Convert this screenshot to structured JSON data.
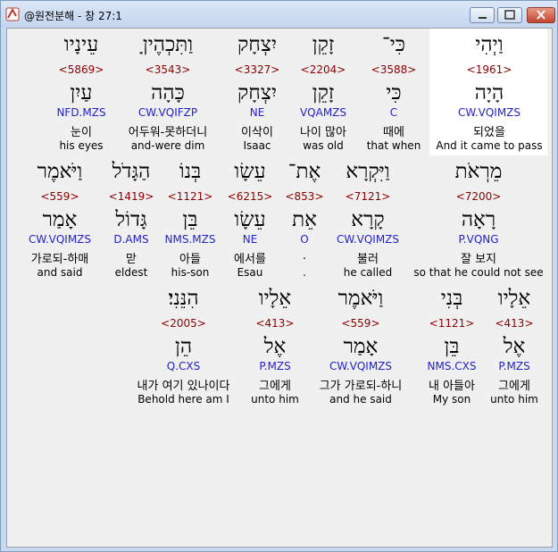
{
  "window": {
    "title": "@원전분해 - 창 27:1"
  },
  "rows": [
    {
      "words": [
        {
          "heb": "וַיְהִי",
          "strong": "<1961>",
          "lemma": "הָיָה",
          "morph": "CW.VQIMZS",
          "kor": "되었을",
          "eng": "And it came to pass"
        },
        {
          "heb": "כִּי־",
          "strong": "<3588>",
          "lemma": "כִּי",
          "morph": "C",
          "kor": "때에",
          "eng": "that when"
        },
        {
          "heb": "זָקֵן",
          "strong": "<2204>",
          "lemma": "זָקֵן",
          "morph": "VQAMZS",
          "kor": "나이 많아",
          "eng": "was old"
        },
        {
          "heb": "יִצְחָק",
          "strong": "<3327>",
          "lemma": "יִצְחָק",
          "morph": "NE",
          "kor": "이삭이",
          "eng": "Isaac"
        },
        {
          "heb": "וַתִּכְהֶיןָ",
          "strong": "<3543>",
          "lemma": "כָּהָה",
          "morph": "CW.VQIFZP",
          "kor": "어두워-못하더니",
          "eng": "and-were dim"
        },
        {
          "heb": "עֵינָיו",
          "strong": "<5869>",
          "lemma": "עַיִן",
          "morph": "NFD.MZS",
          "kor": "눈이",
          "eng": "his eyes"
        }
      ]
    },
    {
      "words": [
        {
          "heb": "מֵרְאֹת",
          "strong": "<7200>",
          "lemma": "רָאָה",
          "morph": "P.VQNG",
          "kor": "잘 보지",
          "eng": "so that he could not see"
        },
        {
          "heb": "וַיִּקְרָא",
          "strong": "<7121>",
          "lemma": "קָרָא",
          "morph": "CW.VQIMZS",
          "kor": "불러",
          "eng": "he called"
        },
        {
          "heb": "אֶת־",
          "strong": "<853>",
          "lemma": "אֵת",
          "morph": "O",
          "kor": ".",
          "eng": "."
        },
        {
          "heb": "עֵשָׂו",
          "strong": "<6215>",
          "lemma": "עֵשָׂו",
          "morph": "NE",
          "kor": "에서를",
          "eng": "Esau"
        },
        {
          "heb": "בְּנוֹ",
          "strong": "<1121>",
          "lemma": "בֵּן",
          "morph": "NMS.MZS",
          "kor": "아들",
          "eng": "his-son"
        },
        {
          "heb": "הַגָּדֹל",
          "strong": "<1419>",
          "lemma": "גָּדוֹל",
          "morph": "D.AMS",
          "kor": "맏",
          "eng": "eldest"
        },
        {
          "heb": "וַיֹּאמֶר",
          "strong": "<559>",
          "lemma": "אָמַר",
          "morph": "CW.VQIMZS",
          "kor": "가로되-하매",
          "eng": "and said"
        }
      ]
    },
    {
      "words": [
        {
          "heb": "אֵלָיו",
          "strong": "<413>",
          "lemma": "אֶל",
          "morph": "P.MZS",
          "kor": "그에게",
          "eng": "unto him"
        },
        {
          "heb": "בְּנִי",
          "strong": "<1121>",
          "lemma": "בֵּן",
          "morph": "NMS.CXS",
          "kor": "내 아들아",
          "eng": "My son"
        },
        {
          "heb": "וַיֹּאמֶר",
          "strong": "<559>",
          "lemma": "אָמַר",
          "morph": "CW.VQIMZS",
          "kor": "그가 가로되-하니",
          "eng": "and he said"
        },
        {
          "heb": "אֵלָיו",
          "strong": "<413>",
          "lemma": "אֶל",
          "morph": "P.MZS",
          "kor": "그에게",
          "eng": "unto him"
        },
        {
          "heb": "הִנֵּנִי׃",
          "strong": "<2005>",
          "lemma": "הֵן",
          "morph": "Q.CXS",
          "kor": "내가 여기 있나이다",
          "eng": "Behold here am I"
        }
      ]
    }
  ],
  "colors": {
    "strong": "#8b0000",
    "morph": "#2222cc",
    "highlight": "#ffffff"
  }
}
